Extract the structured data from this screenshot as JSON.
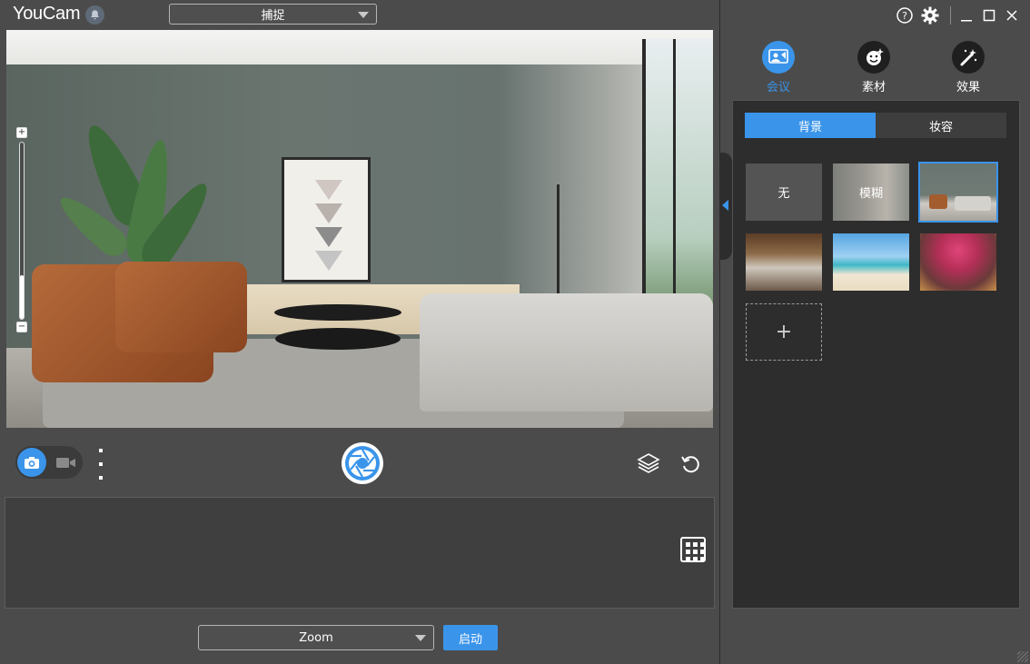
{
  "app": {
    "title": "YouCam"
  },
  "header": {
    "mode_select": "捕捉"
  },
  "camera": {
    "zoom_level": 0.25
  },
  "bottom": {
    "source_select": "Zoom",
    "start_label": "启动"
  },
  "categories": [
    {
      "label": "会议",
      "icon": "conference-icon",
      "active": true
    },
    {
      "label": "素材",
      "icon": "sticker-face-icon",
      "active": false
    },
    {
      "label": "效果",
      "icon": "magic-wand-icon",
      "active": false
    }
  ],
  "subtabs": [
    {
      "label": "背景",
      "active": true
    },
    {
      "label": "妆容",
      "active": false
    }
  ],
  "backgrounds": [
    {
      "label": "无",
      "kind": "none"
    },
    {
      "label": "模糊",
      "kind": "blur"
    },
    {
      "label": "",
      "kind": "living-room",
      "selected": true
    },
    {
      "label": "",
      "kind": "cafe"
    },
    {
      "label": "",
      "kind": "beach"
    },
    {
      "label": "",
      "kind": "blossom-tree"
    }
  ],
  "add_tile": "+",
  "colors": {
    "accent": "#3a94ea",
    "panel": "#2d2d2d",
    "window": "#4b4b4b"
  }
}
